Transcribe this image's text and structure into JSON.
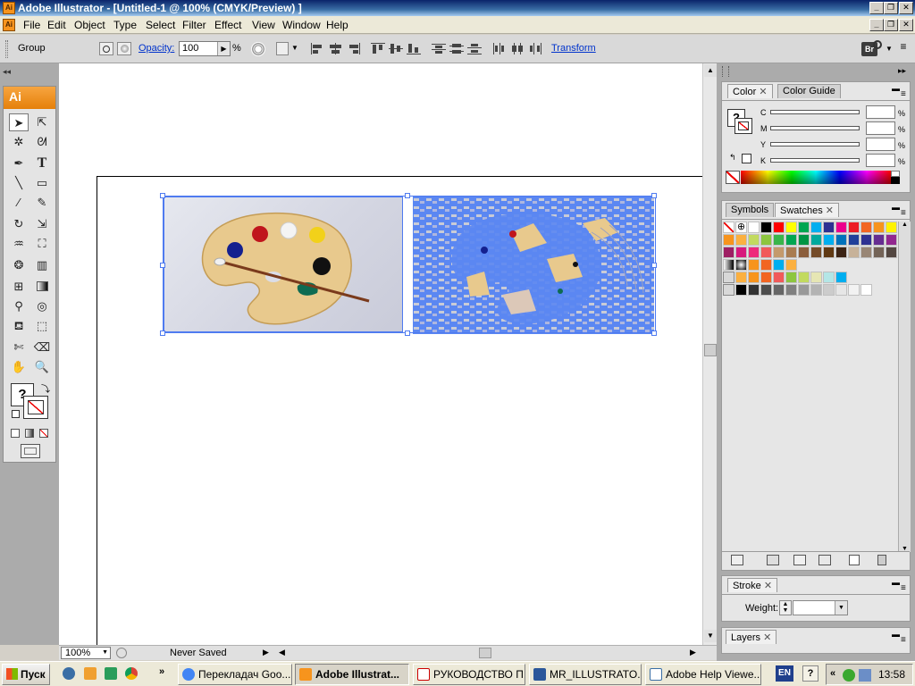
{
  "window": {
    "title": "Adobe Illustrator - [Untitled-1 @ 100% (CMYK/Preview) ]",
    "icon_text": "Ai"
  },
  "menu": [
    "File",
    "Edit",
    "Object",
    "Type",
    "Select",
    "Filter",
    "Effect",
    "View",
    "Window",
    "Help"
  ],
  "control_bar": {
    "selection": "Group",
    "opacity_label": "Opacity:",
    "opacity_value": "100",
    "opacity_unit": "%",
    "transform_label": "Transform",
    "bridge_label": "Br"
  },
  "tools_panel": {
    "logo": "Ai",
    "fill_unknown": "?"
  },
  "status_bar": {
    "zoom": "100%",
    "status": "Never Saved"
  },
  "color_panel": {
    "tabs": [
      "Color",
      "Color Guide"
    ],
    "fill_unknown": "?",
    "channels": [
      {
        "label": "C",
        "unit": "%"
      },
      {
        "label": "M",
        "unit": "%"
      },
      {
        "label": "Y",
        "unit": "%"
      },
      {
        "label": "K",
        "unit": "%"
      }
    ]
  },
  "swatches_panel": {
    "tabs": [
      "Symbols",
      "Swatches"
    ]
  },
  "stroke_panel": {
    "tab": "Stroke",
    "weight_label": "Weight:"
  },
  "layers_panel": {
    "tab": "Layers"
  },
  "taskbar": {
    "start": "Пуск",
    "tasks": [
      {
        "label": "Перекладач Goo...",
        "icon_color": "#4285f4"
      },
      {
        "label": "Adobe Illustrat...",
        "icon_color": "#f7941d",
        "active": true
      },
      {
        "label": "РУКОВОДСТВО П...",
        "icon_color": "#cc0000"
      },
      {
        "label": "MR_ILLUSTRATO...",
        "icon_color": "#2b579a"
      },
      {
        "label": "Adobe Help Viewe...",
        "icon_color": "#3a6ea5"
      }
    ],
    "lang": "EN",
    "clock": "13:58"
  },
  "colors": {
    "selection": "#4f7bf0",
    "accent": "#f7941d"
  }
}
